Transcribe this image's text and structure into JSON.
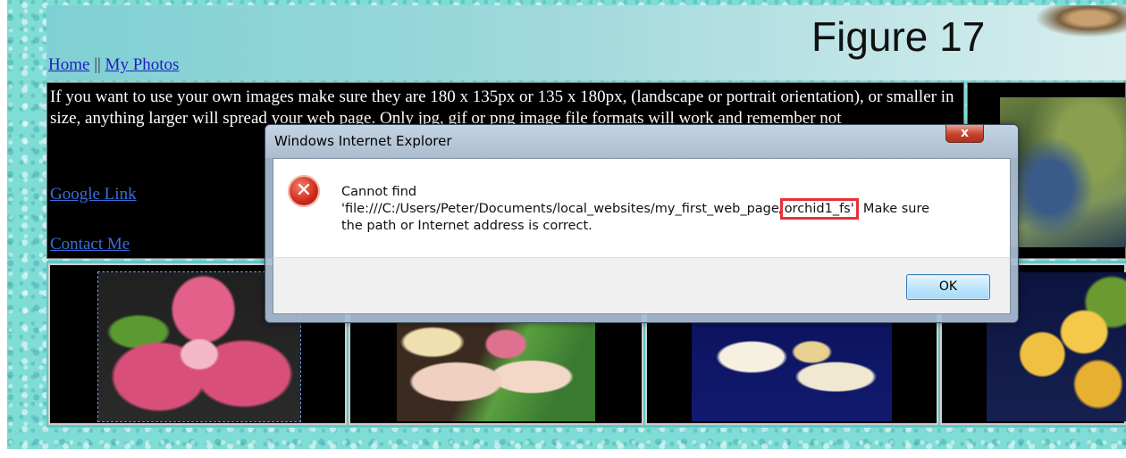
{
  "page": {
    "figure_label": "Figure 17",
    "nav": {
      "home": "Home",
      "separator": "||",
      "photos": "My Photos"
    },
    "intro_text": "If you want to use your own images make sure they are 180 x 135px or 135 x 180px, (landscape or portrait orientation), or smaller in size, anything larger will spread your web page. Only jpg, gif or png image file formats will work and remember not",
    "google_link": "Google Link",
    "contact_link": "Contact Me"
  },
  "dialog": {
    "title": "Windows Internet Explorer",
    "close_glyph": "x",
    "icon_glyph": "✕",
    "message_line1": "Cannot find",
    "message_path_prefix": "'file:///C:/Users/Peter/Documents/local_websites/my_first_web_page/",
    "message_highlight": "orchid1_fs'",
    "message_suffix": ". Make sure",
    "message_line3": "the path or Internet address is correct.",
    "ok_label": "OK"
  },
  "colors": {
    "highlight_box": "#e8303a",
    "link": "#2020c0",
    "background": "#7fdcd6"
  }
}
